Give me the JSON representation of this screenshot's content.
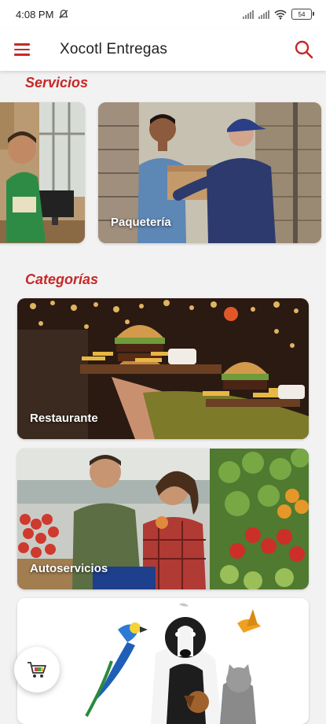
{
  "status": {
    "time": "4:08 PM",
    "battery": "54"
  },
  "appbar": {
    "title": "Xocotl Entregas"
  },
  "sections": {
    "services_title": "Servicios",
    "categories_title": "Categorías"
  },
  "services": [
    {
      "label": ""
    },
    {
      "label": "Paquetería"
    }
  ],
  "categories": [
    {
      "label": "Restaurante"
    },
    {
      "label": "Autoservicios"
    },
    {
      "label": ""
    }
  ],
  "colors": {
    "accent": "#c62828",
    "background": "#f2f2f2"
  },
  "icons": {
    "menu": "hamburger-menu-icon",
    "search": "search-icon",
    "cart": "shopping-cart-icon"
  }
}
